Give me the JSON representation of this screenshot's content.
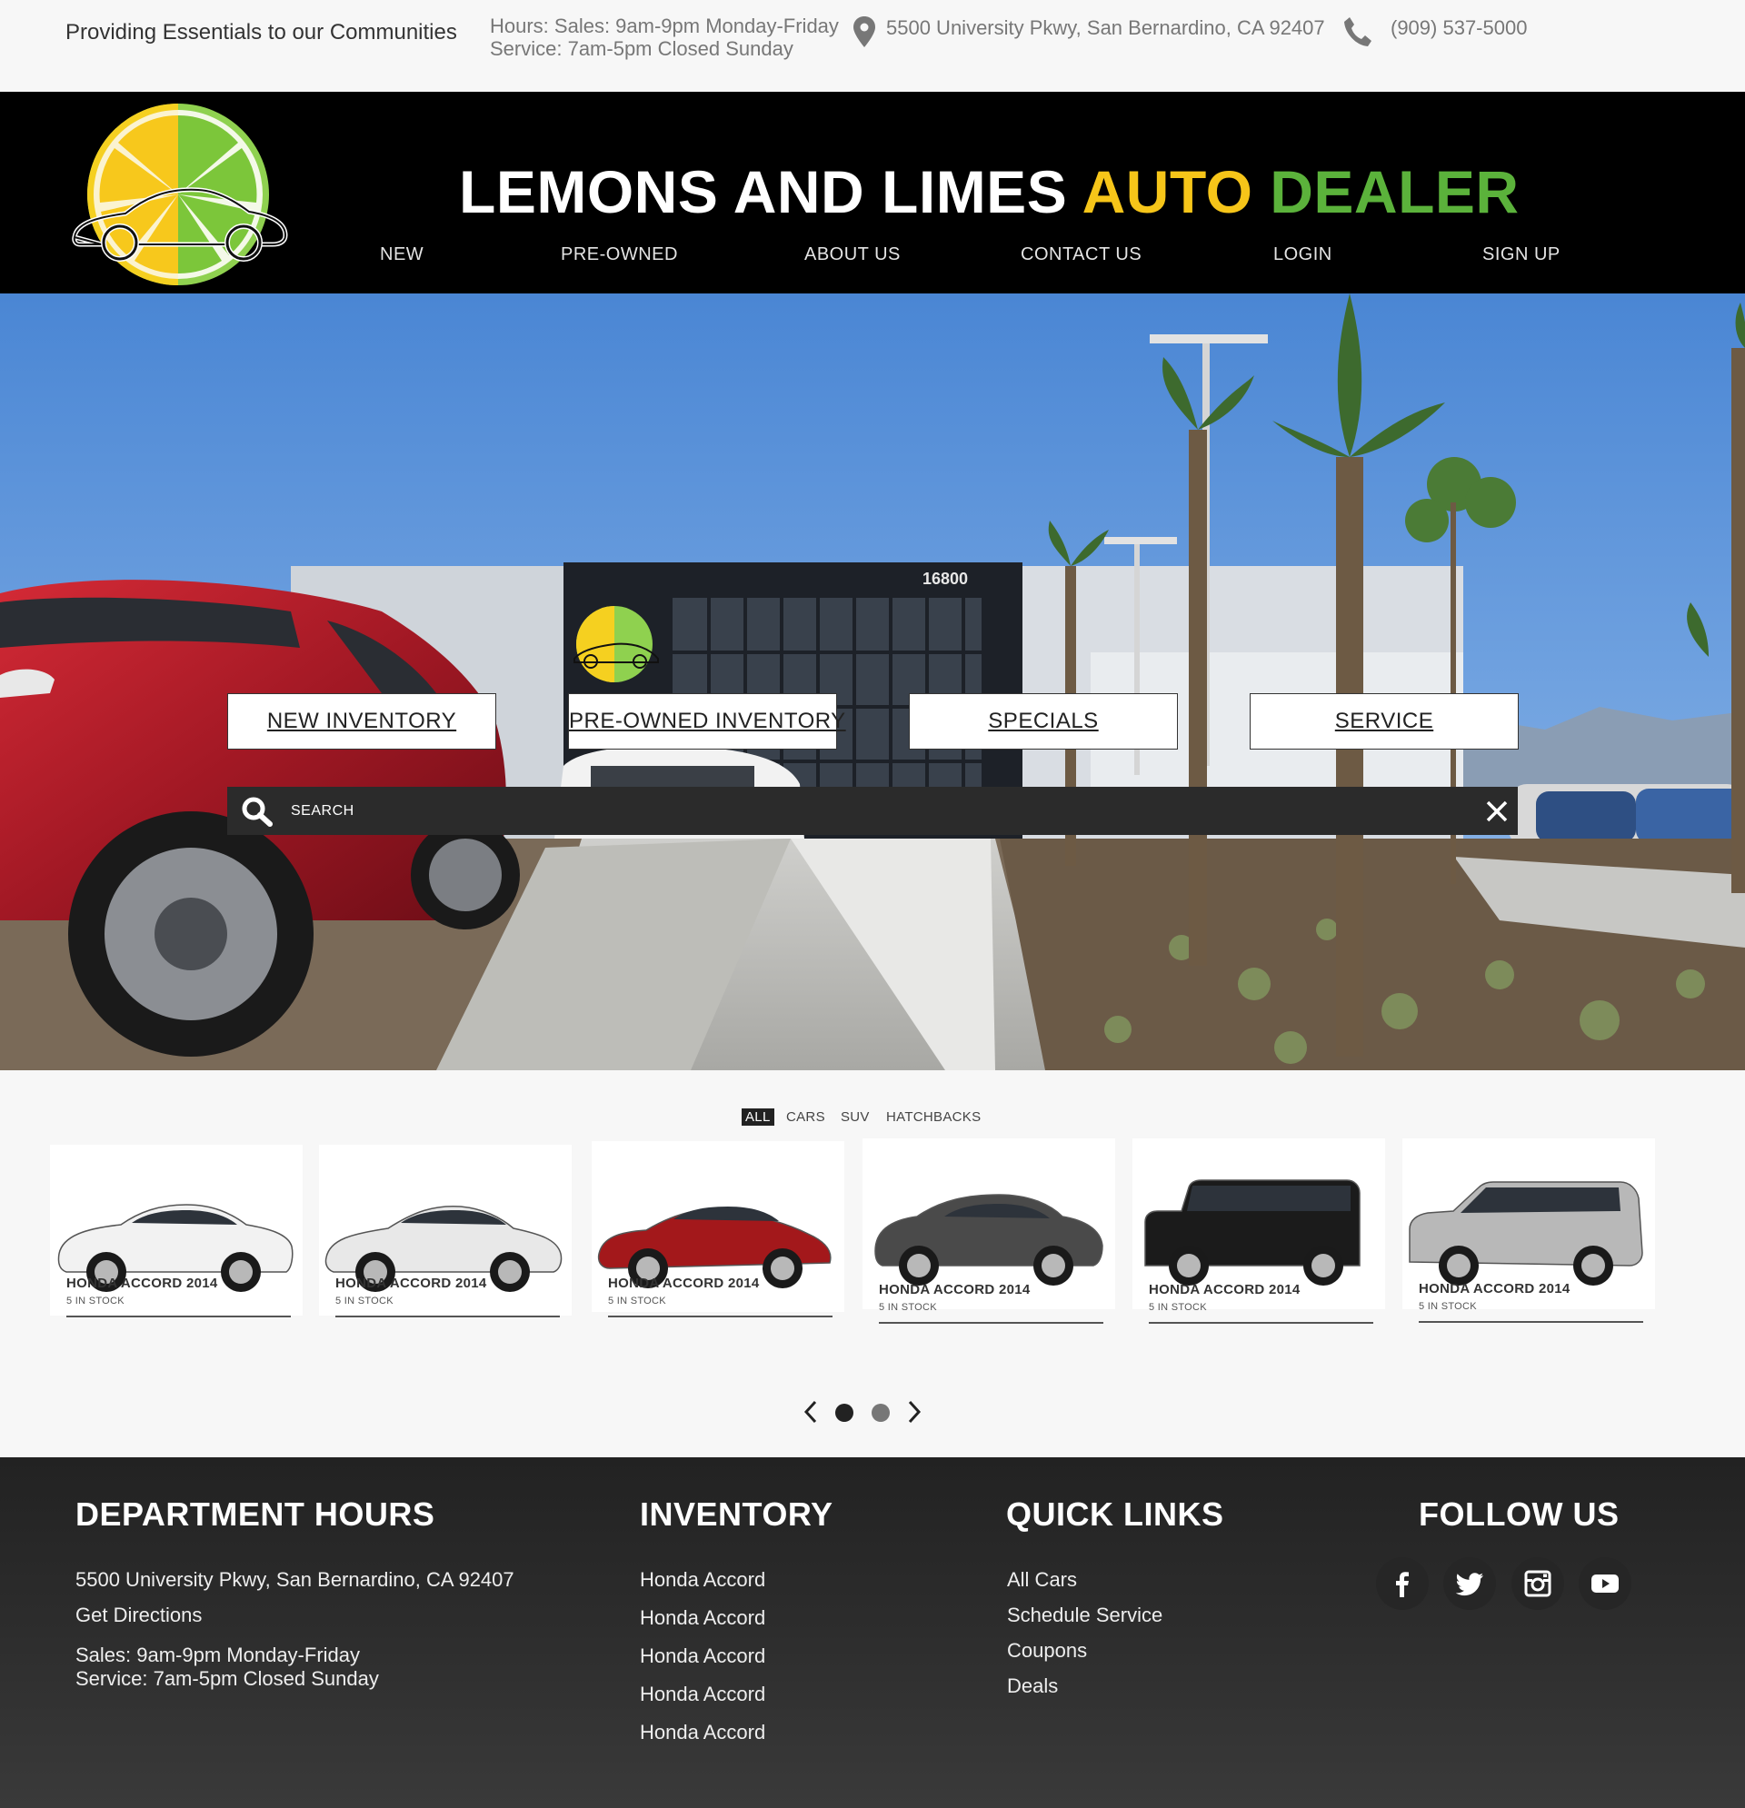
{
  "topbar": {
    "tagline": "Providing Essentials to our Communities",
    "hours_line1": "Hours: Sales: 9am-9pm Monday-Friday",
    "hours_line2": "Service: 7am-5pm Closed Sunday",
    "address": "5500 University Pkwy, San Bernardino, CA 92407",
    "phone": "(909) 537-5000",
    "location_icon": "map-pin-icon",
    "phone_icon": "phone-icon"
  },
  "brand": {
    "part1": "LEMONS AND LIMES ",
    "part2": "AUTO ",
    "part3": "DEALER",
    "colors": {
      "white": "#ffffff",
      "auto": "#f6c519",
      "dealer": "#5bb23b",
      "header_bg": "#000000"
    }
  },
  "nav": [
    "NEW",
    "PRE-OWNED",
    "ABOUT US",
    "CONTACT US",
    "LOGIN",
    "SIGN UP"
  ],
  "hero": {
    "building_number": "16800",
    "buttons": [
      "NEW INVENTORY",
      "PRE-OWNED INVENTORY",
      "SPECIALS",
      "SERVICE"
    ],
    "search_placeholder": "SEARCH",
    "search_icon": "search-icon",
    "clear_icon": "close-icon"
  },
  "inventory": {
    "filters": [
      "ALL",
      "CARS",
      "SUV",
      "HATCHBACKS"
    ],
    "active_filter": "ALL",
    "cards": [
      {
        "title": "HONDA ACCORD 2014",
        "stock": "5 IN STOCK",
        "car_color": "#f2f2f2"
      },
      {
        "title": "HONDA ACCORD 2014",
        "stock": "5 IN STOCK",
        "car_color": "#e8e8e8"
      },
      {
        "title": "HONDA ACCORD 2014",
        "stock": "5 IN STOCK",
        "car_color": "#a3181b"
      },
      {
        "title": "HONDA ACCORD 2014",
        "stock": "5 IN STOCK",
        "car_color": "#4a4a4a"
      },
      {
        "title": "HONDA ACCORD 2014",
        "stock": "5 IN STOCK",
        "car_color": "#1b1b1b"
      },
      {
        "title": "HONDA ACCORD 2014",
        "stock": "5 IN STOCK",
        "car_color": "#b8b8b8"
      }
    ],
    "pager": {
      "current_page": 1,
      "total_pages": 2
    }
  },
  "footer": {
    "dept": {
      "heading": "DEPARTMENT HOURS",
      "address": "5500 University Pkwy, San Bernardino, CA 92407",
      "directions": "Get Directions",
      "sales": "Sales: 9am-9pm Monday-Friday",
      "service": "Service: 7am-5pm Closed Sunday"
    },
    "inventory": {
      "heading": "INVENTORY",
      "items": [
        "Honda Accord",
        "Honda Accord",
        "Honda Accord",
        "Honda Accord",
        "Honda Accord"
      ]
    },
    "quick_links": {
      "heading": "QUICK LINKS",
      "items": [
        "All Cars",
        "Schedule Service",
        "Coupons",
        "Deals"
      ]
    },
    "follow": {
      "heading": "FOLLOW US",
      "icons": [
        "facebook-icon",
        "twitter-icon",
        "instagram-icon",
        "youtube-icon"
      ]
    }
  }
}
